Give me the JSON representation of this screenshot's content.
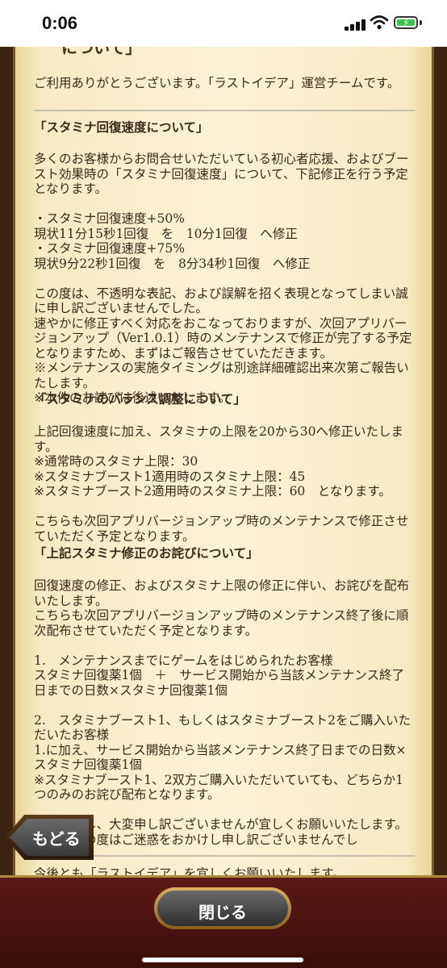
{
  "status": {
    "time": "0:06"
  },
  "header": {
    "title_partial": "について」"
  },
  "intro": "ご利用ありがとうございます。「ラストイデア」運営チームです。",
  "sections": [
    {
      "heading": "「スタミナ回復速度について」",
      "body": "多くのお客様からお問合せいただいている初心者応援、およびブースト効果時の「スタミナ回復速度」について、下記修正を行う予定となります。\n\n・スタミナ回復速度+50%\n現状11分15秒1回復　を　10分1回復　へ修正\n・スタミナ回復速度+75%\n現状9分22秒1回復　を　8分34秒1回復　へ修正\n\nこの度は、不透明な表記、および誤解を招く表現となってしまい誠に申し訳ございませんでした。\n速やかに修正すべく対応をおこなっておりますが、次回アプリバージョンアップ（Ver1.0.1）時のメンテナンスで修正が完了する予定となりますため、まずはご報告させていただきます。\n※メンテナンスの実施タイミングは別途詳細確認出来次第ご報告いたします。\n※本件のお詫びは後述いたします。"
    },
    {
      "heading": "「スタミナのバランス調整について」",
      "body": "上記回復速度に加え、スタミナの上限を20から30へ修正いたします。\n※通常時のスタミナ上限：30\n※スタミナブースト1適用時のスタミナ上限：45\n※スタミナブースト2適用時のスタミナ上限：60　となります。\n\nこちらも次回アプリバージョンアップ時のメンテナンスで修正させていただく予定となります。"
    },
    {
      "heading": "「上記スタミナ修正のお詫びについて」",
      "body": "回復速度の修正、およびスタミナ上限の修正に伴い、お詫びを配布いたします。\nこちらも次回アプリバージョンアップ時のメンテナンス終了後に順次配布させていただく予定となります。\n\n1.　メンテナンスまでにゲームをはじめられたお客様\nスタミナ回復薬1個　＋　サービス開始から当該メンテナンス終了日までの日数×スタミナ回復薬1個\n\n2.　スタミナブースト1、もしくはスタミナブースト2をご購入いただいたお客様\n1.に加え、サービス開始から当該メンテナンス終了日までの日数×スタミナ回復薬1個\n※スタミナブースト1、2双方ご購入いただいていても、どちらか1つのみのお詫び配布となります。\n\nお待たせし、大変申し訳ございませんが宜しくお願いいたします。\nまた、この度はご迷惑をおかけし申し訳ございませんでし"
    }
  ],
  "cut_line": "今後とも「ラストイデア」を宜しくお願いいたします。",
  "buttons": {
    "back": "もどる",
    "close": "閉じる"
  }
}
